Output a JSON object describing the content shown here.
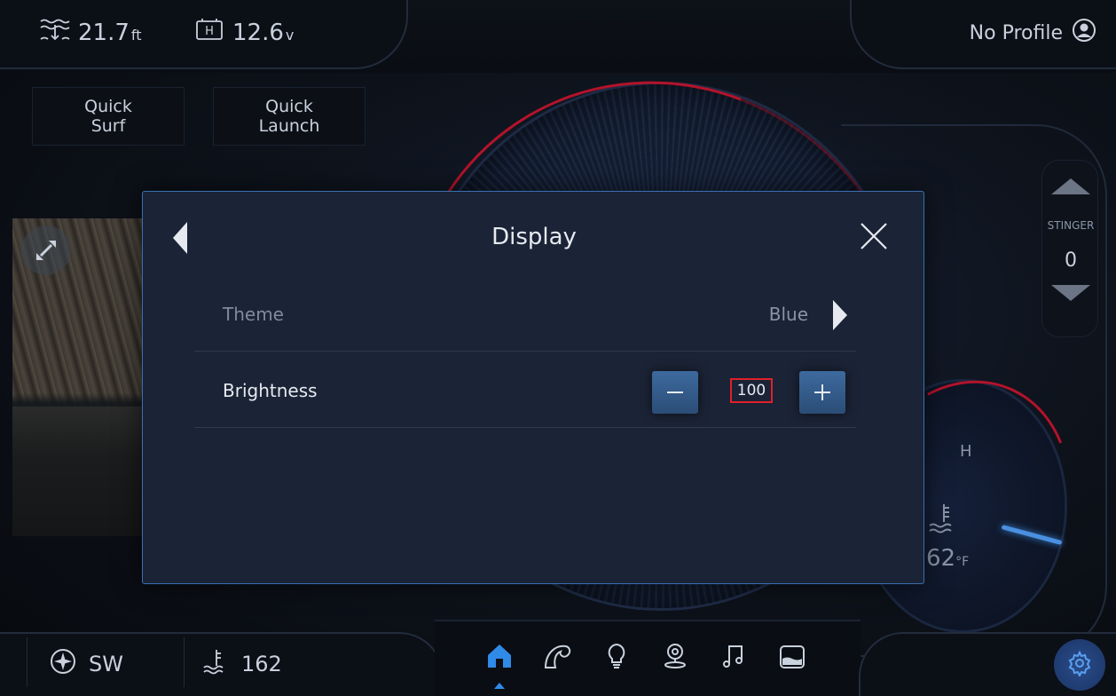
{
  "status_bar": {
    "depth_value": "21.7",
    "depth_unit": "ft",
    "battery_value": "12.6",
    "battery_unit": "v",
    "profile_label": "No Profile"
  },
  "quick_buttons": [
    {
      "line1": "Quick",
      "line2": "Surf"
    },
    {
      "line1": "Quick",
      "line2": "Launch"
    }
  ],
  "stinger": {
    "label": "STINGER",
    "value": "0"
  },
  "engine_temp": {
    "hot_label": "H",
    "value": "62",
    "unit": "°F"
  },
  "bottom": {
    "heading": "SW",
    "water_temp_value": "162"
  },
  "nav_icons": [
    "home-icon",
    "wave-icon",
    "light-bulb-icon",
    "location-pin-icon",
    "music-note-icon",
    "ballast-tank-icon"
  ],
  "modal": {
    "title": "Display",
    "theme_label": "Theme",
    "theme_value": "Blue",
    "brightness_label": "Brightness",
    "brightness_value": "100"
  },
  "colors": {
    "accent": "#2f8ae8",
    "warning": "#b3132b",
    "modal_bg": "#1b2336",
    "stepper_highlight": "#e0202a"
  }
}
